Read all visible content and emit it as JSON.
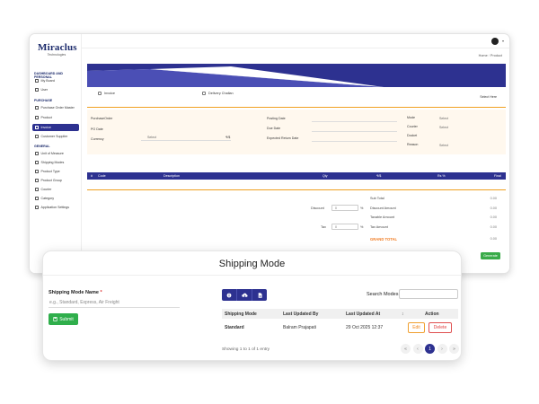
{
  "app": {
    "logo_main": "Miraclus",
    "logo_sub": "Technologies"
  },
  "sidebar": {
    "sections": [
      {
        "title": "DASHBOARD AND PERSONAL",
        "items": [
          {
            "label": "My Board"
          },
          {
            "label": "User"
          }
        ]
      },
      {
        "title": "PURCHASE",
        "items": [
          {
            "label": "Purchase Order Master"
          },
          {
            "label": "Product"
          },
          {
            "label": "Invoice",
            "active": true
          },
          {
            "label": "Customer Supplier"
          }
        ]
      },
      {
        "title": "GENERAL",
        "items": [
          {
            "label": "Unit of Measure"
          },
          {
            "label": "Shipping Modes"
          },
          {
            "label": "Product Type"
          },
          {
            "label": "Product Group"
          },
          {
            "label": "Courier"
          },
          {
            "label": "Category"
          },
          {
            "label": "Application Settings"
          }
        ]
      }
    ]
  },
  "breadcrumb": {
    "home": "Home",
    "sep": "/",
    "current": "Product"
  },
  "invoice": {
    "option_invoice": "Invoice",
    "option_challan": "Delivery Challan",
    "select_here": "Select Here",
    "fields": {
      "purchase_order": "PurchaseOrder",
      "po_date": "PO Date",
      "currency": "Currency",
      "currency_value": "Select",
      "currency_symbol": "₹/$",
      "posting_date": "Posting Date",
      "due_date": "Due Date",
      "expected_return": "Expected Return Date",
      "mode": "Mode",
      "mode_value": "Select",
      "courier": "Courier",
      "courier_value": "Select",
      "docket": "Docket",
      "reason": "Reason",
      "reason_value": "Select"
    },
    "table_headers": [
      "#",
      "Code",
      "Description",
      "Qty",
      "₹/$",
      "Rs %",
      "Final"
    ],
    "totals": {
      "sub_total_label": "Sub Total",
      "sub_total": "0.00",
      "discount_label": "Discount",
      "discount_pct": "0",
      "discount_amount_label": "Discount Amount",
      "discount_amount": "0.00",
      "taxable_label": "Taxable Amount",
      "taxable": "0.00",
      "tax_label": "Tax",
      "tax_pct": "0",
      "tax_amount_label": "Tax Amount",
      "tax_amount": "0.00",
      "grand_label": "GRAND TOTAL",
      "grand": "0.00",
      "pct_symbol": "%"
    },
    "generate_label": "Generate"
  },
  "shipping": {
    "title": "Shipping Mode",
    "name_label": "Shipping Mode Name",
    "required_mark": "*",
    "name_placeholder": "e.g., Standard, Express, Air Freight",
    "submit_label": "Submit",
    "search_label": "Search Modes:",
    "table": {
      "headers": [
        "Shipping Mode",
        "Last Updated By",
        "Last Updated At",
        "↕",
        "Action"
      ],
      "rows": [
        {
          "mode": "Standard",
          "by": "Balram Prajapati",
          "at": "29 Oct 2025 12:37"
        }
      ]
    },
    "edit_label": "Edit",
    "delete_label": "Delete",
    "showing": "Showing 1 to 1 of 1 entry",
    "pager": [
      "«",
      "‹",
      "1",
      "›",
      "»"
    ]
  },
  "colors": {
    "primary": "#2d3190",
    "success": "#2fae4b",
    "accent": "#f07a20",
    "danger": "#e04040"
  }
}
